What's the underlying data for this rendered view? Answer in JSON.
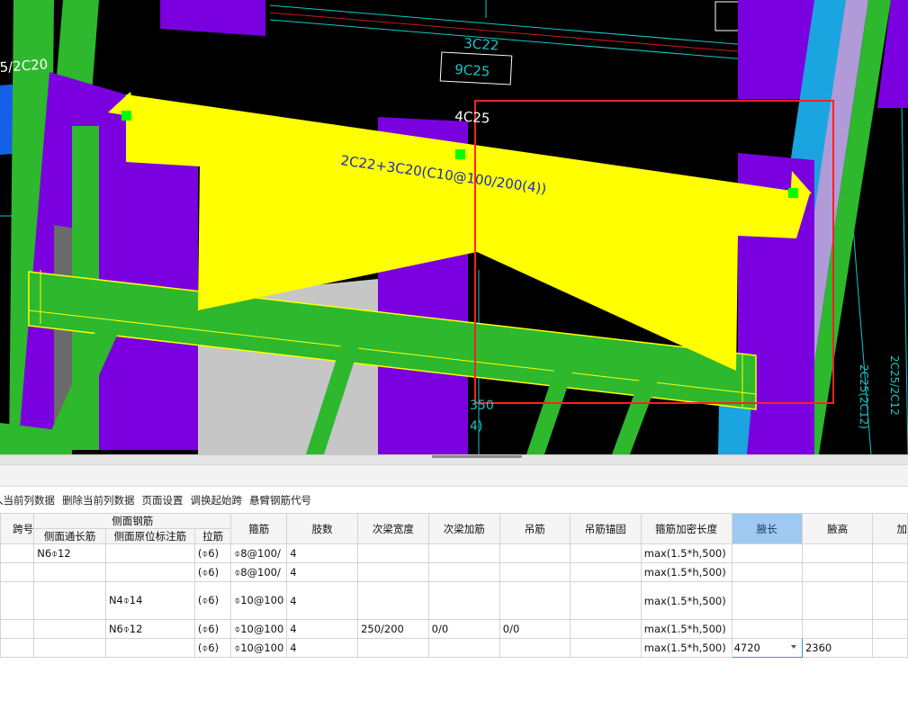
{
  "viewport": {
    "labels": {
      "left_top": "5/2C20",
      "mid_top_1": "3C22",
      "mid_top_2": "9C25",
      "beam_top": "4C25",
      "beam_spec": "2C22+3C20(C10@100/200(4))",
      "lower_1": "350",
      "lower_2": "4)",
      "right_1": "2C25/2C12",
      "right_2": "2C25(2C12)"
    },
    "colors": {
      "background": "#000000",
      "beam_yellow": "#ffff00",
      "column_purple": "#7a00e0",
      "green": "#2db82d",
      "blue": "#1aa5e0",
      "selection_red": "#ff2020",
      "grip_green": "#00ff00"
    }
  },
  "toolbar": {
    "items": [
      "入当前列数据",
      "删除当前列数据",
      "页面设置",
      "调换起始跨",
      "悬臂钢筋代号"
    ]
  },
  "grid": {
    "header": {
      "span_no": "跨号",
      "side_group": "侧面钢筋",
      "side_through": "侧面通长筋",
      "side_original": "侧面原位标注筋",
      "tie_bar": "拉筋",
      "stirrup": "箍筋",
      "legs": "肢数",
      "secondary_width": "次梁宽度",
      "secondary_extra": "次梁加筋",
      "hanger": "吊筋",
      "hanger_anchor": "吊筋锚固",
      "dense_length": "箍筋加密长度",
      "haunch_length": "腋长",
      "haunch_height": "腋高",
      "next": "加"
    },
    "rows": [
      {
        "span": "",
        "side_through": "N6⌽12",
        "side_original": "",
        "tie": "(⌽6)",
        "stirrup": "⌽8@100/",
        "legs": "4",
        "sec_width": "",
        "sec_extra": "",
        "hanger": "",
        "anchor": "",
        "dense": "max(1.5*h,500)",
        "h_len": "",
        "h_height": ""
      },
      {
        "span": "",
        "side_through": "",
        "side_original": "",
        "tie": "(⌽6)",
        "stirrup": "⌽8@100/",
        "legs": "4",
        "sec_width": "",
        "sec_extra": "",
        "hanger": "",
        "anchor": "",
        "dense": "max(1.5*h,500)",
        "h_len": "",
        "h_height": ""
      },
      {
        "span": "",
        "side_through": "",
        "side_original": "N4⌽14",
        "tie": "(⌽6)",
        "stirrup": "⌽10@100",
        "legs": "4",
        "sec_width": "",
        "sec_extra": "",
        "hanger": "",
        "anchor": "",
        "dense": "max(1.5*h,500)",
        "h_len": "",
        "h_height": ""
      },
      {
        "span": "",
        "side_through": "",
        "side_original": "N6⌽12",
        "tie": "(⌽6)",
        "stirrup": "⌽10@100",
        "legs": "4",
        "sec_width": "250/200",
        "sec_extra": "0/0",
        "hanger": "0/0",
        "anchor": "",
        "dense": "max(1.5*h,500)",
        "h_len": "",
        "h_height": ""
      },
      {
        "span": "",
        "side_through": "",
        "side_original": "",
        "tie": "(⌽6)",
        "stirrup": "⌽10@100",
        "legs": "4",
        "sec_width": "",
        "sec_extra": "",
        "hanger": "",
        "anchor": "",
        "dense": "max(1.5*h,500)",
        "h_len": "4720",
        "h_height": "2360"
      }
    ]
  }
}
